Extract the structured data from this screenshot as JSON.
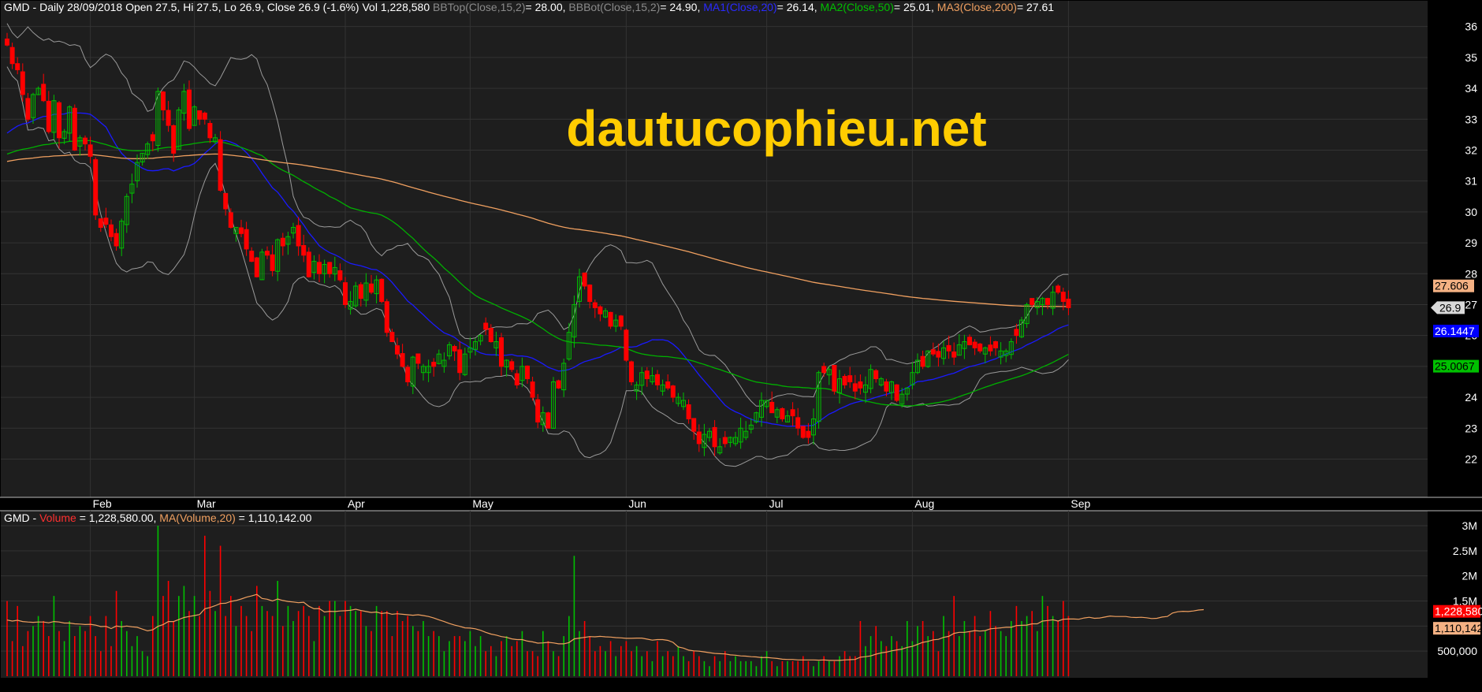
{
  "ticker": "GMD",
  "header_price": {
    "label": "GMD - Daily 28/09/2018 Open 27.5, Hi 27.5, Lo 26.9, Close 26.9 (-1.6%) Vol 1,228,580",
    "bbtop_label": "BBTop(Close,15,2)",
    "bbtop_value": "= 28.00,",
    "bbbot_label": "BBBot(Close,15,2)",
    "bbbot_value": "= 24.90,",
    "ma1_label": "MA1(Close,20)",
    "ma1_value": "= 26.14,",
    "ma2_label": "MA2(Close,50)",
    "ma2_value": "= 25.01,",
    "ma3_label": "MA3(Close,200)",
    "ma3_value": "= 27.61"
  },
  "header_volume": {
    "prefix": "GMD -",
    "vol_label": "Volume",
    "vol_value": "= 1,228,580.00,",
    "ma_label": "MA(Volume,20)",
    "ma_value": "= 1,110,142.00"
  },
  "watermark": "dautucophieu.net",
  "price_tags": {
    "ma3": "27.606",
    "close": "26.9",
    "ma1": "26.1447",
    "ma2": "25.0067"
  },
  "volume_tags": {
    "volume": "1,228,580",
    "ma": "1,110,142"
  },
  "colors": {
    "background": "#000000",
    "panel": "#1e1e1e",
    "grid": "#333333",
    "up": "#00c000",
    "down": "#ff0000",
    "bollinger": "#9a9a9a",
    "ma1": "#1a1aff",
    "ma2": "#00b000",
    "ma3": "#f0a060",
    "watermark": "#ffcc00"
  },
  "chart_data": [
    {
      "type": "candlestick",
      "title": "GMD - Daily 28/09/2018",
      "y_ticks": [
        22,
        23,
        24,
        25,
        26,
        27,
        28,
        29,
        30,
        31,
        32,
        33,
        34,
        35,
        36
      ],
      "ylim": [
        21.4,
        36.4
      ],
      "x_labels": [
        "Feb",
        "Mar",
        "Apr",
        "May",
        "Jun",
        "Jul",
        "Aug",
        "Sep"
      ],
      "x_label_index": [
        16,
        36,
        65,
        89,
        119,
        146,
        174,
        204
      ],
      "close": [
        35.4,
        34.8,
        34.6,
        33.8,
        33.0,
        33.8,
        34.0,
        33.6,
        32.6,
        33.6,
        32.4,
        32.6,
        33.4,
        32.0,
        32.4,
        32.2,
        31.8,
        29.9,
        29.5,
        29.6,
        29.2,
        28.9,
        29.7,
        30.5,
        30.9,
        31.6,
        31.9,
        32.2,
        32.3,
        33.9,
        33.3,
        32.8,
        31.9,
        33.3,
        33.9,
        32.7,
        33.4,
        33.0,
        33.0,
        32.4,
        32.4,
        30.7,
        30.1,
        29.5,
        29.5,
        29.3,
        28.8,
        28.4,
        27.9,
        28.7,
        28.6,
        28.1,
        29.1,
        28.9,
        29.2,
        29.5,
        28.9,
        28.6,
        27.9,
        28.4,
        28.0,
        28.3,
        28.0,
        28.2,
        27.8,
        27.0,
        27.1,
        27.6,
        27.2,
        27.7,
        27.4,
        27.8,
        27.1,
        26.1,
        25.8,
        25.4,
        25.0,
        24.5,
        25.3,
        25.1,
        25.0,
        25.0,
        25.0,
        25.4,
        25.2,
        25.7,
        25.5,
        24.8,
        25.4,
        25.6,
        25.8,
        26.0,
        26.2,
        25.8,
        25.8,
        25.0,
        25.2,
        24.9,
        24.4,
        25.0,
        24.6,
        24.0,
        23.2,
        23.5,
        23.0,
        24.5,
        24.3,
        25.1,
        26.1,
        27.0,
        27.9,
        27.6,
        27.1,
        26.9,
        26.7,
        26.8,
        26.3,
        26.5,
        26.3,
        25.2,
        24.5,
        24.4,
        24.8,
        24.6,
        24.7,
        24.4,
        24.4,
        24.3,
        24.0,
        24.0,
        23.9,
        23.3,
        22.9,
        22.5,
        22.8,
        22.9,
        22.4,
        22.4,
        22.5,
        22.7,
        22.7,
        23.0,
        22.9,
        23.1,
        23.5,
        23.9,
        23.9,
        23.5,
        23.6,
        23.3,
        23.4,
        23.4,
        23.0,
        22.7,
        22.7,
        23.3,
        24.8,
        24.8,
        24.9,
        24.2,
        24.6,
        24.4,
        24.5,
        24.2,
        24.3,
        24.4,
        24.9,
        24.6,
        24.6,
        24.2,
        24.5,
        23.9,
        24.1,
        24.3,
        24.8,
        25.2,
        25.0,
        25.5,
        25.4,
        25.3,
        25.6,
        25.5,
        25.3,
        25.7,
        25.8,
        25.7,
        25.6,
        25.5,
        25.6,
        25.5,
        25.6,
        25.5,
        25.5,
        25.8,
        26.0,
        26.5,
        27.0,
        27.0,
        27.1,
        27.2,
        27.0,
        27.4,
        27.4,
        27.1,
        26.9
      ]
    },
    {
      "type": "bar",
      "title": "GMD - Volume",
      "y_ticks": [
        "500,000",
        "1M",
        "1.5M",
        "2M",
        "2.5M",
        "3M"
      ],
      "y_tick_values": [
        500000,
        1000000,
        1500000,
        2000000,
        2500000,
        3000000
      ],
      "ylim": [
        0,
        3000000
      ],
      "volume_units": "millions",
      "volume": [
        1.5,
        0.7,
        1.4,
        0.6,
        0.9,
        1.0,
        1.2,
        1.1,
        0.8,
        1.6,
        0.9,
        0.7,
        1.1,
        0.8,
        1.0,
        0.9,
        1.2,
        0.8,
        0.5,
        1.2,
        0.6,
        1.7,
        1.1,
        0.9,
        0.6,
        0.8,
        0.5,
        0.4,
        1.2,
        3.0,
        1.6,
        1.9,
        1.1,
        1.6,
        1.8,
        1.3,
        1.6,
        1.2,
        2.8,
        1.7,
        1.3,
        2.6,
        1.2,
        1.6,
        1.0,
        1.4,
        1.2,
        0.9,
        1.8,
        1.4,
        1.3,
        1.2,
        1.9,
        1.0,
        1.4,
        1.1,
        1.3,
        1.4,
        1.2,
        0.7,
        1.4,
        1.2,
        1.5,
        1.5,
        1.2,
        1.5,
        1.4,
        1.3,
        1.3,
        1.0,
        0.9,
        1.4,
        1.3,
        1.3,
        0.8,
        1.3,
        1.1,
        1.2,
        1.0,
        0.9,
        1.1,
        0.8,
        0.9,
        0.8,
        0.5,
        0.7,
        0.8,
        0.8,
        0.7,
        0.9,
        0.6,
        0.8,
        0.5,
        0.6,
        0.4,
        0.7,
        0.8,
        0.6,
        0.7,
        0.9,
        0.5,
        0.5,
        0.4,
        0.9,
        0.7,
        0.5,
        0.4,
        0.8,
        1.2,
        2.4,
        0.9,
        1.1,
        0.8,
        0.5,
        0.6,
        0.5,
        0.7,
        0.4,
        0.6,
        0.7,
        0.5,
        0.6,
        0.4,
        0.5,
        0.3,
        0.7,
        0.4,
        0.5,
        0.4,
        0.6,
        0.4,
        0.3,
        0.5,
        0.4,
        0.3,
        0.2,
        0.4,
        0.3,
        0.5,
        0.3,
        0.4,
        0.3,
        0.3,
        0.3,
        0.2,
        0.4,
        0.5,
        0.3,
        0.2,
        0.3,
        0.3,
        0.3,
        0.3,
        0.4,
        0.3,
        0.2,
        0.3,
        0.4,
        0.3,
        0.3,
        0.4,
        0.5,
        0.4,
        0.4,
        1.1,
        0.6,
        0.8,
        1.0,
        0.7,
        0.6,
        0.8,
        0.7,
        0.6,
        1.1,
        0.7,
        1.0,
        1.1,
        0.8,
        0.9,
        0.5,
        1.2,
        0.9,
        1.6,
        0.8,
        1.1,
        0.9,
        1.2,
        0.8,
        0.9,
        1.3,
        1.0,
        0.9,
        0.8,
        1.1,
        1.4,
        1.1,
        1.2,
        1.3,
        0.9,
        1.6,
        1.4,
        1.2,
        1.1,
        1.5,
        1.2,
        0.9,
        1.1,
        1.3,
        1.2,
        0.9,
        1.1,
        1.3,
        1.2,
        0.9,
        1.4,
        1.1,
        0.9,
        1.2,
        1.0,
        1.4,
        1.1,
        1.3,
        1.6,
        1.7,
        2.6,
        1.4,
        1.3,
        1.2,
        1.4,
        1.3,
        1.23
      ]
    }
  ]
}
